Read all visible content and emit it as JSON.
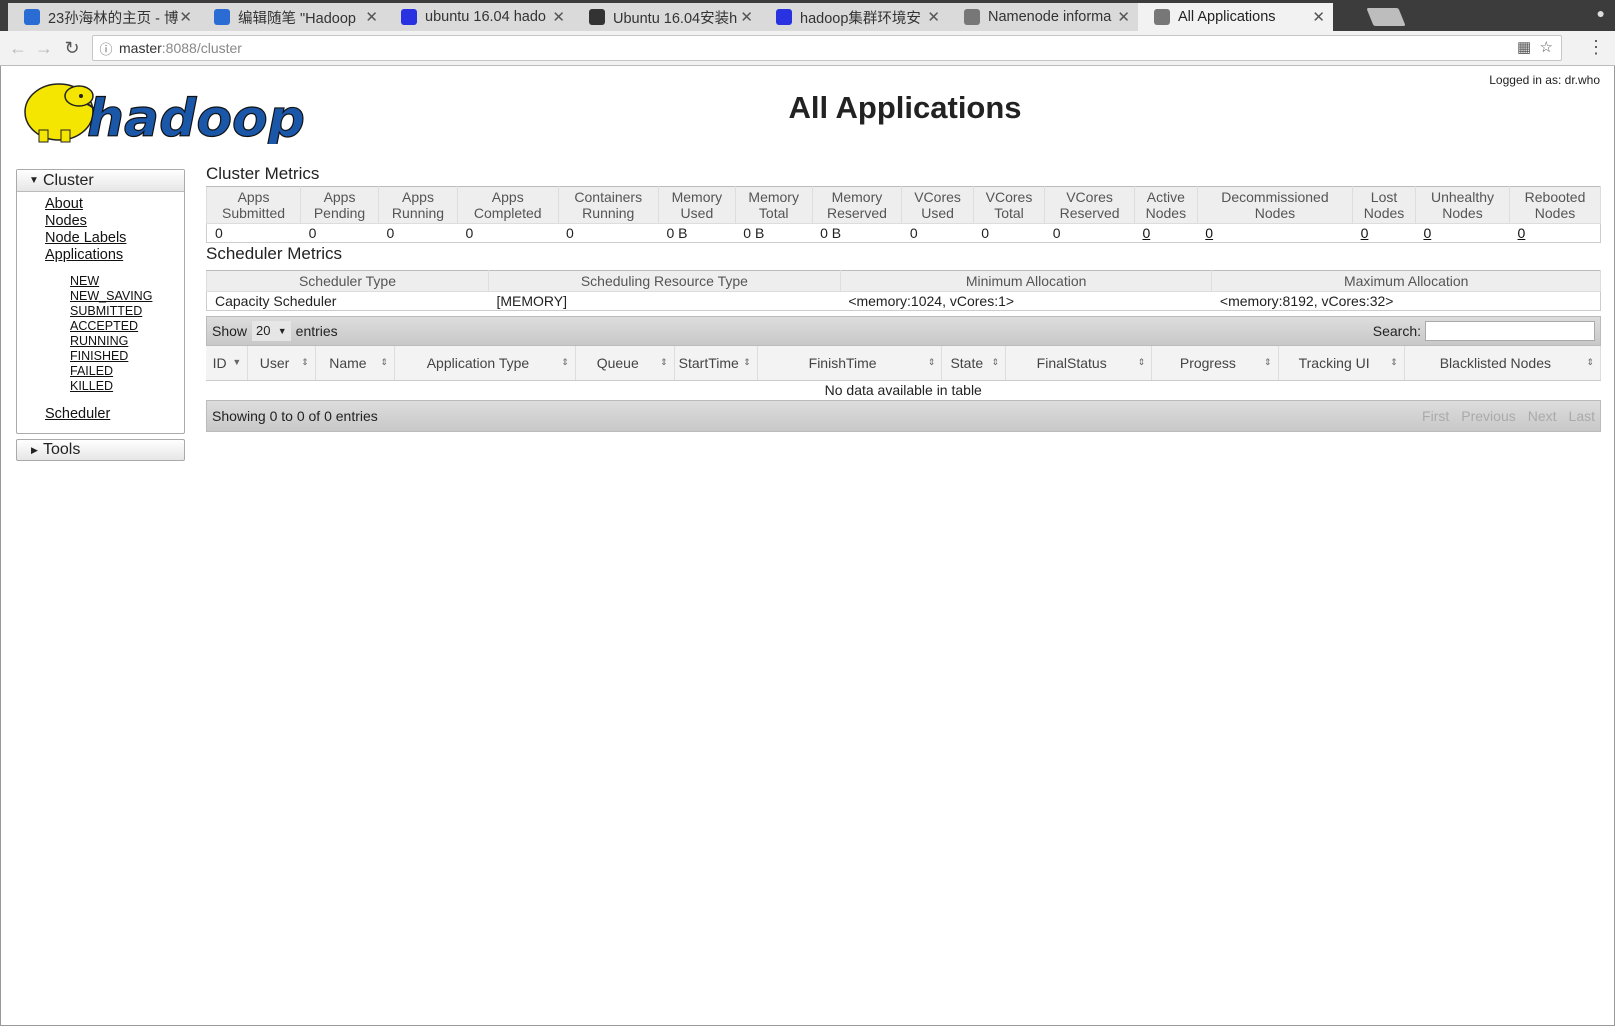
{
  "browser": {
    "tabs": [
      {
        "title": "23孙海林的主页 - 博",
        "icon": "cnblogs-icon",
        "color": "#2b6cd4"
      },
      {
        "title": "编辑随笔 \"Hadoop",
        "icon": "cnblogs-icon",
        "color": "#2b6cd4"
      },
      {
        "title": "ubuntu 16.04 hado",
        "icon": "baidu-paw-icon",
        "color": "#2932e1"
      },
      {
        "title": "Ubuntu 16.04安装h",
        "icon": "linux-tux-icon",
        "color": "#333333"
      },
      {
        "title": "hadoop集群环境安",
        "icon": "baidu-paw-icon",
        "color": "#2932e1"
      },
      {
        "title": "Namenode informa",
        "icon": "page-icon",
        "color": "#777777"
      },
      {
        "title": "All Applications",
        "icon": "page-icon",
        "color": "#777777"
      }
    ],
    "url_host": "master",
    "url_path": ":8088/cluster"
  },
  "header": {
    "title": "All Applications",
    "logged_in": "Logged in as: dr.who",
    "logo_text": "hadoop"
  },
  "sidebar": {
    "cluster_label": "Cluster",
    "links": [
      "About",
      "Nodes",
      "Node Labels",
      "Applications"
    ],
    "app_states": [
      "NEW",
      "NEW_SAVING",
      "SUBMITTED",
      "ACCEPTED",
      "RUNNING",
      "FINISHED",
      "FAILED",
      "KILLED"
    ],
    "scheduler_label": "Scheduler",
    "tools_label": "Tools"
  },
  "cluster_metrics": {
    "heading": "Cluster Metrics",
    "headers": [
      [
        "Apps",
        "Submitted"
      ],
      [
        "Apps",
        "Pending"
      ],
      [
        "Apps",
        "Running"
      ],
      [
        "Apps",
        "Completed"
      ],
      [
        "Containers",
        "Running"
      ],
      [
        "Memory",
        "Used"
      ],
      [
        "Memory",
        "Total"
      ],
      [
        "Memory",
        "Reserved"
      ],
      [
        "VCores",
        "Used"
      ],
      [
        "VCores",
        "Total"
      ],
      [
        "VCores",
        "Reserved"
      ],
      [
        "Active",
        "Nodes"
      ],
      [
        "Decommissioned",
        "Nodes"
      ],
      [
        "Lost",
        "Nodes"
      ],
      [
        "Unhealthy",
        "Nodes"
      ],
      [
        "Rebooted",
        "Nodes"
      ]
    ],
    "values": [
      "0",
      "0",
      "0",
      "0",
      "0",
      "0 B",
      "0 B",
      "0 B",
      "0",
      "0",
      "0",
      "0",
      "0",
      "0",
      "0",
      "0"
    ]
  },
  "scheduler_metrics": {
    "heading": "Scheduler Metrics",
    "headers": [
      "Scheduler Type",
      "Scheduling Resource Type",
      "Minimum Allocation",
      "Maximum Allocation"
    ],
    "values": [
      "Capacity Scheduler",
      "[MEMORY]",
      "<memory:1024, vCores:1>",
      "<memory:8192, vCores:32>"
    ]
  },
  "apps_table": {
    "show_label": "Show",
    "entries_value": "20",
    "entries_label": "entries",
    "search_label": "Search:",
    "columns": [
      "ID",
      "User",
      "Name",
      "Application Type",
      "Queue",
      "StartTime",
      "FinishTime",
      "State",
      "FinalStatus",
      "Progress",
      "Tracking UI",
      "Blacklisted Nodes"
    ],
    "empty_text": "No data available in table",
    "info": "Showing 0 to 0 of 0 entries",
    "pager": [
      "First",
      "Previous",
      "Next",
      "Last"
    ]
  }
}
